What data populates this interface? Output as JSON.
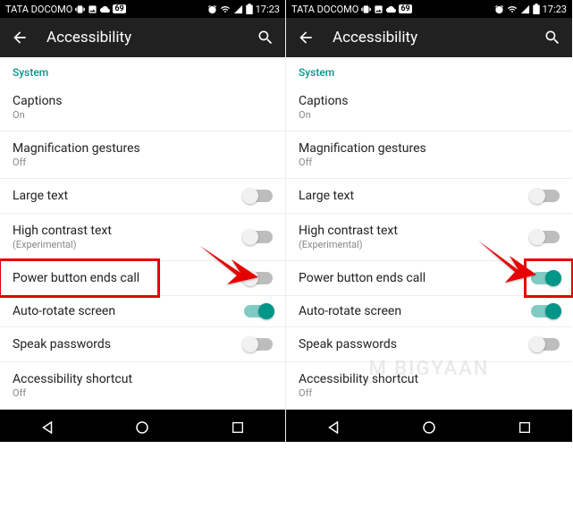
{
  "status": {
    "carrier": "TATA DOCOMO",
    "badge": "69",
    "time": "17:23"
  },
  "appbar": {
    "title": "Accessibility"
  },
  "section": "System",
  "rows": {
    "captions": {
      "title": "Captions",
      "sub": "On"
    },
    "mag": {
      "title": "Magnification gestures",
      "sub": "Off"
    },
    "large": {
      "title": "Large text"
    },
    "contrast": {
      "title": "High contrast text",
      "sub": "(Experimental)"
    },
    "power": {
      "title": "Power button ends call"
    },
    "rotate": {
      "title": "Auto-rotate screen"
    },
    "speak": {
      "title": "Speak passwords"
    },
    "shortcut": {
      "title": "Accessibility shortcut",
      "sub": "Off"
    }
  },
  "toggles": {
    "left": {
      "large": "off",
      "contrast": "off",
      "power": "off",
      "rotate": "on",
      "speak": "off"
    },
    "right": {
      "large": "off",
      "contrast": "off",
      "power": "on",
      "rotate": "on",
      "speak": "off"
    }
  },
  "watermark": "M   BIGYAAN"
}
